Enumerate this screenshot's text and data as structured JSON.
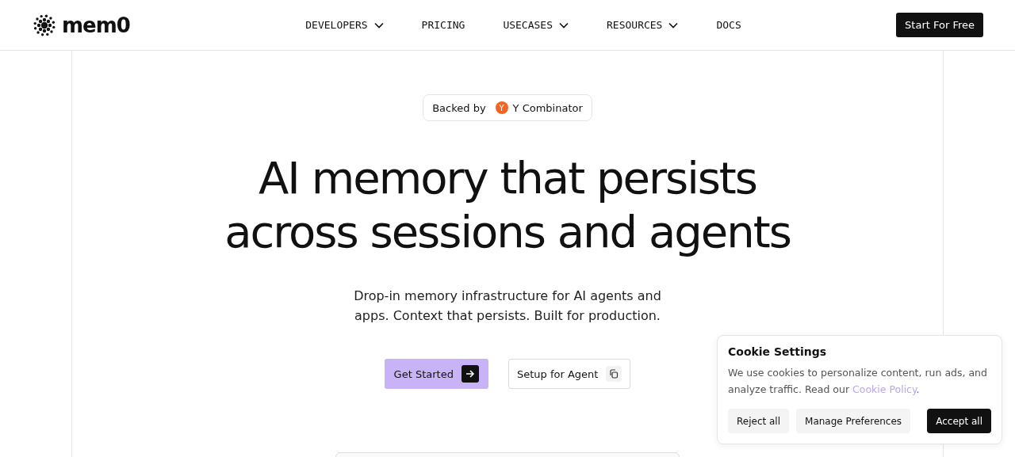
{
  "header": {
    "logo": "mem0",
    "nav": [
      {
        "label": "DEVELOPERS",
        "has_menu": true
      },
      {
        "label": "PRICING",
        "has_menu": false
      },
      {
        "label": "USECASES",
        "has_menu": true
      },
      {
        "label": "RESOURCES",
        "has_menu": true
      },
      {
        "label": "DOCS",
        "has_menu": false
      }
    ],
    "cta": "Start For Free"
  },
  "hero": {
    "badge": {
      "prefix": "Backed by",
      "logo_letter": "Y",
      "name": "Y Combinator"
    },
    "title_lines": [
      "AI memory that persists",
      "across sessions and agents"
    ],
    "subtitle": "Drop-in memory infrastructure for AI agents and apps. Context that persists. Built for production.",
    "primary_button": "Get Started",
    "secondary_button": "Setup for Agent"
  },
  "cookie_dialog": {
    "title": "Cookie Settings",
    "text": "We use cookies to personalize content, run ads, and analyze traffic. Read our ",
    "link": "Cookie Policy",
    "text_end": ".",
    "buttons": [
      {
        "label": "Reject all",
        "kind": "secondary"
      },
      {
        "label": "Manage Preferences",
        "kind": "secondary"
      },
      {
        "label": "Accept all",
        "kind": "primary"
      }
    ]
  }
}
